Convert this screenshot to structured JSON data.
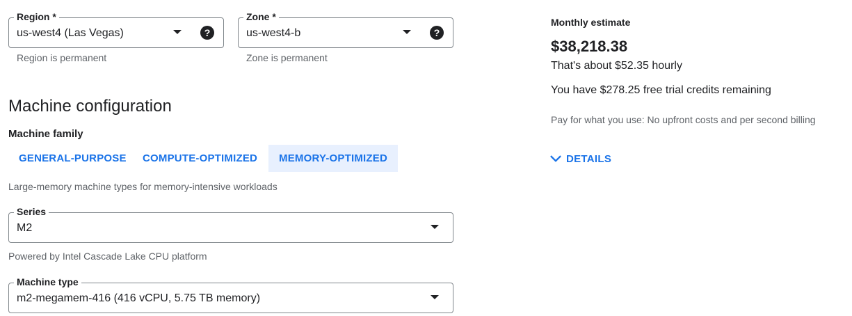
{
  "region": {
    "label": "Region *",
    "value": "us-west4 (Las Vegas)",
    "help_icon": "?",
    "hint": "Region is permanent"
  },
  "zone": {
    "label": "Zone *",
    "value": "us-west4-b",
    "help_icon": "?",
    "hint": "Zone is permanent"
  },
  "machine_config": {
    "title": "Machine configuration",
    "family_label": "Machine family",
    "tabs": [
      {
        "label": "GENERAL-PURPOSE",
        "selected": false
      },
      {
        "label": "COMPUTE-OPTIMIZED",
        "selected": false
      },
      {
        "label": "MEMORY-OPTIMIZED",
        "selected": true
      }
    ],
    "family_description": "Large-memory machine types for memory-intensive workloads",
    "series": {
      "label": "Series",
      "value": "M2",
      "hint": "Powered by Intel Cascade Lake CPU platform"
    },
    "machine_type": {
      "label": "Machine type",
      "value": "m2-megamem-416 (416 vCPU, 5.75 TB memory)"
    }
  },
  "estimate": {
    "label": "Monthly estimate",
    "price": "$38,218.38",
    "hourly": "That's about $52.35 hourly",
    "credits": "You have $278.25 free trial credits remaining",
    "pay_note": "Pay for what you use: No upfront costs and per second billing",
    "details_label": "DETAILS"
  },
  "colors": {
    "accent": "#1a73e8",
    "selected_tab_bg": "#e8f0fe",
    "hint_text": "#5f6368",
    "border": "#80868b"
  }
}
